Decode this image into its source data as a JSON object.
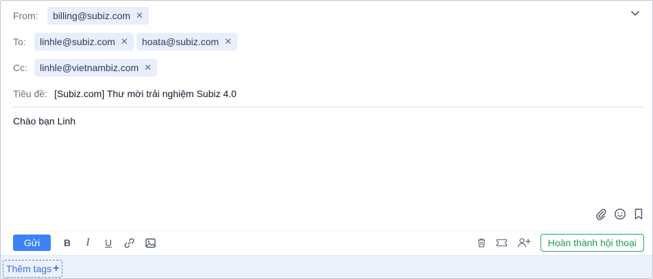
{
  "from": {
    "label": "From:",
    "chips": [
      "billing@subiz.com"
    ]
  },
  "to": {
    "label": "To:",
    "chips": [
      "linhle@subiz.com",
      "hoata@subiz.com"
    ]
  },
  "cc": {
    "label": "Cc:",
    "chips": [
      "linhle@vietnambiz.com"
    ]
  },
  "subject": {
    "label": "Tiêu đề:",
    "value": "[Subiz.com] Thư mời trải nghiệm Subiz 4.0"
  },
  "body": {
    "text": "Chào bạn Linh"
  },
  "toolbar": {
    "send_label": "Gửi",
    "bold": "B",
    "italic": "I",
    "underline": "U",
    "done_label": "Hoàn thành hội thoại"
  },
  "footer": {
    "tags_label": "Thêm tags",
    "tags_plus": "+"
  },
  "colors": {
    "accent": "#3b82f6",
    "chip_bg": "#e9eefb",
    "success": "#22a55b",
    "footer_bg": "#edf2fa"
  },
  "icons": [
    "chevron-down-icon",
    "close-icon",
    "paperclip-icon",
    "smile-icon",
    "bookmark-icon",
    "link-icon",
    "image-icon",
    "trash-icon",
    "ticket-icon",
    "add-user-icon"
  ]
}
